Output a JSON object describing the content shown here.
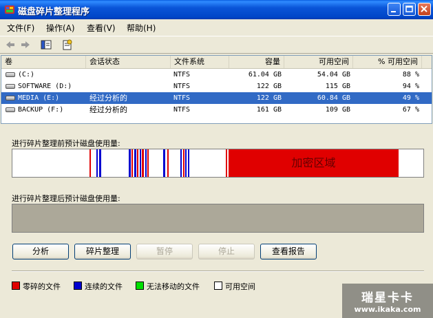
{
  "window": {
    "title": "磁盘碎片整理程序",
    "icon": "defrag-app-icon",
    "controls": [
      "minimize-icon",
      "maximize-icon",
      "close-icon"
    ]
  },
  "menu": [
    {
      "label": "文件(F)"
    },
    {
      "label": "操作(A)"
    },
    {
      "label": "查看(V)"
    },
    {
      "label": "帮助(H)"
    }
  ],
  "toolbar": {
    "icons": [
      "back-arrow-icon",
      "forward-arrow-icon",
      "console-view-icon",
      "properties-icon"
    ]
  },
  "volumes": {
    "columns": [
      "卷",
      "会话状态",
      "文件系统",
      "容量",
      "可用空间",
      "% 可用空间"
    ],
    "rows": [
      {
        "volume": "(C:)",
        "status": "",
        "fs": "NTFS",
        "capacity": "61.04 GB",
        "free": "54.04 GB",
        "pct": "88 %",
        "selected": false
      },
      {
        "volume": "SOFTWARE (D:)",
        "status": "",
        "fs": "NTFS",
        "capacity": "122 GB",
        "free": "115 GB",
        "pct": "94 %",
        "selected": false
      },
      {
        "volume": "MEDIA (E:)",
        "status": "经过分析的",
        "fs": "NTFS",
        "capacity": "122 GB",
        "free": "60.84 GB",
        "pct": "49 %",
        "selected": true
      },
      {
        "volume": "BACKUP (F:)",
        "status": "经过分析的",
        "fs": "NTFS",
        "capacity": "161 GB",
        "free": "109 GB",
        "pct": "67 %",
        "selected": false
      }
    ]
  },
  "before": {
    "label": "进行碎片整理前预计磁盘使用量:",
    "encrypted_label": "加密区域"
  },
  "after": {
    "label": "进行碎片整理后预计磁盘使用量:"
  },
  "buttons": [
    {
      "label": "分析",
      "enabled": true
    },
    {
      "label": "碎片整理",
      "enabled": true
    },
    {
      "label": "暂停",
      "enabled": false
    },
    {
      "label": "停止",
      "enabled": false
    },
    {
      "label": "查看报告",
      "enabled": true
    }
  ],
  "legend": [
    {
      "label": "零碎的文件",
      "color": "#e00000"
    },
    {
      "label": "连续的文件",
      "color": "#0000d0"
    },
    {
      "label": "无法移动的文件",
      "color": "#00e000"
    },
    {
      "label": "可用空间",
      "color": "#ffffff"
    }
  ],
  "watermark": {
    "line1": "瑞星卡卡",
    "line2": "www.ikaka.com"
  },
  "colors": {
    "fragmented": "#e00000",
    "contiguous": "#0000d0",
    "unmovable": "#00e000",
    "free": "#ffffff",
    "selection": "#316ac5"
  }
}
